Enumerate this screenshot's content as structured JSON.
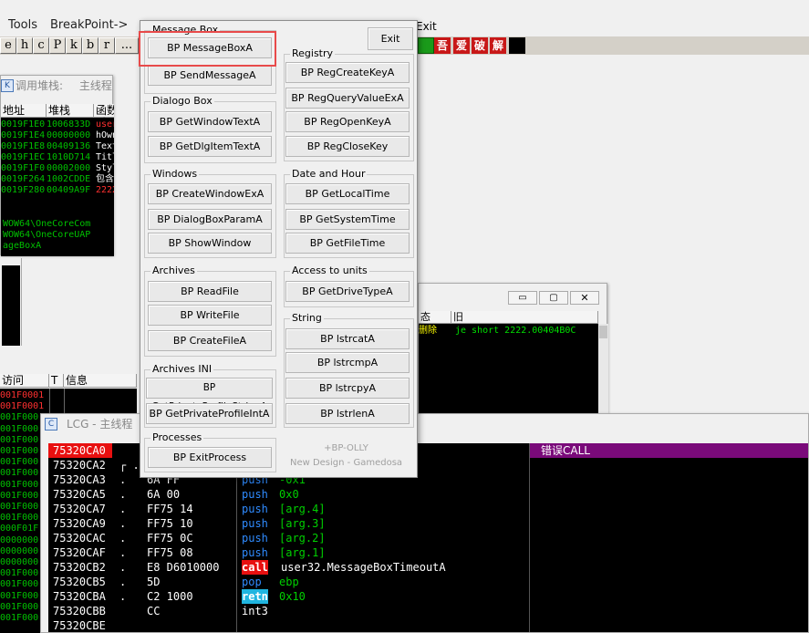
{
  "menu": {
    "tools": "Tools",
    "breakpoint": "BreakPoint->"
  },
  "toolbar": {
    "letters": [
      "e",
      "h",
      "c",
      "P",
      "k",
      "b",
      "r"
    ],
    "ellipsis": "...",
    "cn_buttons": [
      "吾",
      "爱",
      "破",
      "解"
    ],
    "exit_label": "Exit"
  },
  "callstack_win": {
    "title": "调用堆栈:",
    "title_thread": "主线程",
    "headers": [
      "地址",
      "堆栈",
      "函数过程"
    ],
    "addr": [
      "0019F1E0",
      "0019F1E4",
      "0019F1E8",
      "0019F1EC",
      "0019F1F0",
      "0019F264",
      "0019F280"
    ],
    "stack": [
      "1006833D",
      "00000000",
      "00409136",
      "1010D714",
      "00002000",
      "1002CDDE",
      "00409A9F"
    ],
    "proc": [
      "user32.M",
      "hOwner",
      "Text =",
      "Title",
      "Style",
      "包含krnl",
      "2222.004"
    ],
    "lines_below": [
      "WOW64\\OneCoreCom",
      "WOW64\\OneCoreUAP",
      "ageBoxA"
    ]
  },
  "breakpoint_win": {
    "headers_left": [
      "访问",
      "T",
      "信息"
    ],
    "col_status": "态",
    "col_old": "旧",
    "row_status": "删除",
    "row_code": "je short 2222.00404B0C",
    "left_addrs": [
      "001F0001",
      "001F0001",
      "001F000",
      "001F000",
      "001F000",
      "001F000",
      "001F000",
      "001F000",
      "001F000",
      "001F000",
      "001F000",
      "001F000",
      "000F01F",
      "0000000",
      "0000000",
      "0000000",
      "001F000",
      "001F000",
      "001F000",
      "001F000",
      "001F000"
    ]
  },
  "cpu_win": {
    "title": "LCG - 主线程",
    "error_label": "错误CALL",
    "rows": [
      {
        "addr": "75320CA0",
        "bracket": "",
        "hex": "",
        "mnemonic": "",
        "operands": ""
      },
      {
        "addr": "75320CA2",
        "bracket": "┌ .",
        "hex": "8BEC",
        "mnemonic": "mov",
        "operands": "ebp,esp"
      },
      {
        "addr": "75320CA3",
        "bracket": ".",
        "hex": "6A FF",
        "mnemonic": "push",
        "operands": "-0x1"
      },
      {
        "addr": "75320CA5",
        "bracket": ".",
        "hex": "6A 00",
        "mnemonic": "push",
        "operands": "0x0"
      },
      {
        "addr": "75320CA7",
        "bracket": ".",
        "hex": "FF75 14",
        "mnemonic": "push",
        "operands": "[arg.4]"
      },
      {
        "addr": "75320CA9",
        "bracket": ".",
        "hex": "FF75 10",
        "mnemonic": "push",
        "operands": "[arg.3]"
      },
      {
        "addr": "75320CAC",
        "bracket": ".",
        "hex": "FF75 0C",
        "mnemonic": "push",
        "operands": "[arg.2]"
      },
      {
        "addr": "75320CAF",
        "bracket": ".",
        "hex": "FF75 08",
        "mnemonic": "push",
        "operands": "[arg.1]"
      },
      {
        "addr": "75320CB2",
        "bracket": ".",
        "hex": "E8 D6010000",
        "mnemonic": "call",
        "operands": "user32.MessageBoxTimeoutA"
      },
      {
        "addr": "75320CB5",
        "bracket": ".",
        "hex": "5D",
        "mnemonic": "pop",
        "operands": "ebp"
      },
      {
        "addr": "75320CBA",
        "bracket": ".",
        "hex": "C2 1000",
        "mnemonic": "retn",
        "operands": "0x10"
      },
      {
        "addr": "75320CBB",
        "bracket": "",
        "hex": "CC",
        "mnemonic": "",
        "operands": "int3"
      },
      {
        "addr": "75320CBE",
        "bracket": "",
        "hex": "",
        "mnemonic": "",
        "operands": ""
      }
    ]
  },
  "dialog": {
    "groups": {
      "message_box": "Message Box",
      "registry": "Registry",
      "dialogo_box": "Dialogo Box",
      "windows": "Windows",
      "date_and_hour": "Date and Hour",
      "archives": "Archives",
      "access_to_units": "Access to units",
      "string": "String",
      "archives_ini": "Archives INI",
      "processes": "Processes"
    },
    "exit_label": "Exit",
    "buttons": {
      "messagebox_a": "BP  MessageBoxA",
      "sendmessage_a": "BP SendMessageA",
      "reg_create_key_a": "BP RegCreateKeyA",
      "reg_query_value_ex_a": "BP RegQueryValueExA",
      "reg_open_key_a": "BP RegOpenKeyA",
      "reg_close_key": "BP RegCloseKey",
      "get_window_text_a": "BP GetWindowTextA",
      "get_dlg_item_text_a": "BP GetDlgItemTextA",
      "create_window_ex_a": "BP CreateWindowExA",
      "dialog_box_param_a": "BP DialogBoxParamA",
      "show_window": "BP ShowWindow",
      "get_local_time": "BP GetLocalTime",
      "get_system_time": "BP GetSystemTime",
      "get_file_time": "BP GetFileTime",
      "read_file": "BP ReadFile",
      "write_file": "BP WriteFile",
      "create_file_a": "BP CreateFileA",
      "get_drive_type_a": "BP GetDriveTypeA",
      "lstrcat_a": "BP lstrcatA",
      "lstrcmp_a": "BP lstrcmpA",
      "lstrcpy_a": "BP lstrcpyA",
      "lstrlen_a": "BP lstrlenA",
      "get_private_profile_string_a": "BP GetPrivateProfileStringA",
      "get_private_profile_int_a": "BP GetPrivateProfileIntA",
      "exit_process": "BP ExitProcess"
    },
    "footer_line1": "+BP-OLLY",
    "footer_line2": "New Design - Gamedosa"
  },
  "colors": {
    "highlight_border": "#e84a4a",
    "disasm_bg": "#000000",
    "selected_row_bg": "#e81010"
  }
}
